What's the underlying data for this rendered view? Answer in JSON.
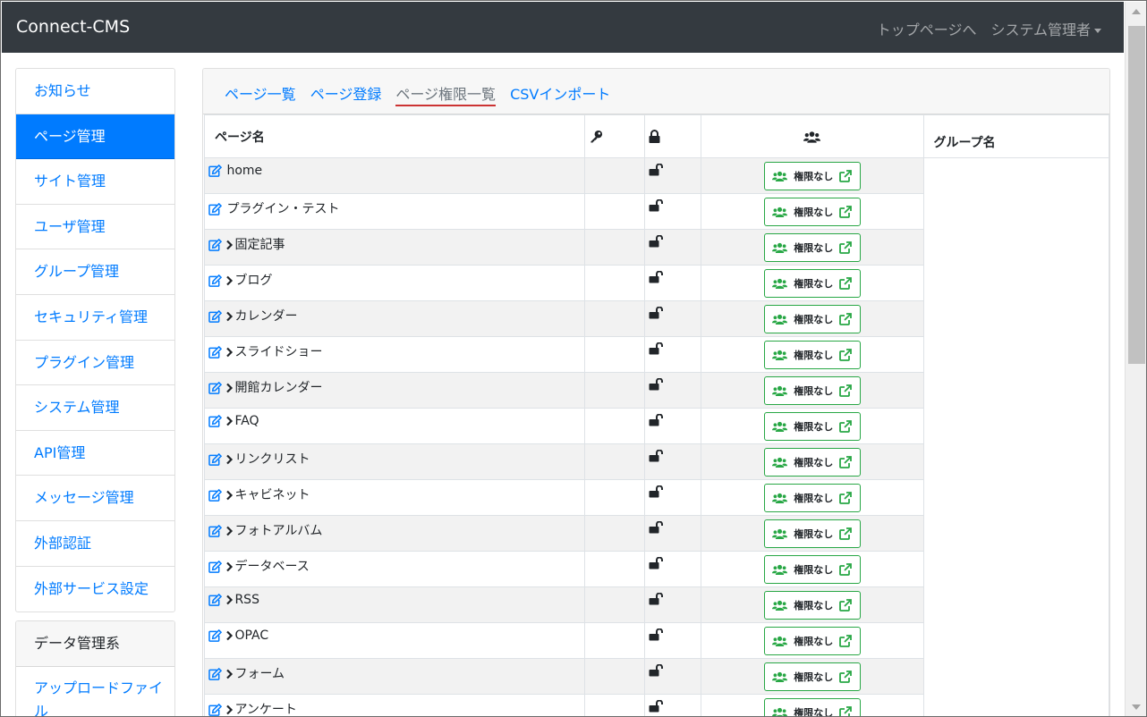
{
  "navbar": {
    "brand": "Connect-CMS",
    "top_page_link": "トップページへ",
    "admin_menu": "システム管理者"
  },
  "sidebar": {
    "items": [
      {
        "label": "お知らせ",
        "active": false
      },
      {
        "label": "ページ管理",
        "active": true
      },
      {
        "label": "サイト管理",
        "active": false
      },
      {
        "label": "ユーザ管理",
        "active": false
      },
      {
        "label": "グループ管理",
        "active": false
      },
      {
        "label": "セキュリティ管理",
        "active": false
      },
      {
        "label": "プラグイン管理",
        "active": false
      },
      {
        "label": "システム管理",
        "active": false
      },
      {
        "label": "API管理",
        "active": false
      },
      {
        "label": "メッセージ管理",
        "active": false
      },
      {
        "label": "外部認証",
        "active": false
      },
      {
        "label": "外部サービス設定",
        "active": false
      }
    ],
    "data_header": "データ管理系",
    "data_items": [
      {
        "label": "アップロードファイル"
      }
    ]
  },
  "tabs": [
    {
      "label": "ページ一覧",
      "current": false
    },
    {
      "label": "ページ登録",
      "current": false
    },
    {
      "label": "ページ権限一覧",
      "current": true
    },
    {
      "label": "CSVインポート",
      "current": false
    }
  ],
  "table": {
    "headers": {
      "page_name": "ページ名",
      "key_icon": "key-icon",
      "lock_icon": "lock-icon",
      "users_icon": "users-icon",
      "group_name": "グループ名"
    },
    "permission_button_label": "権限なし",
    "rows": [
      {
        "name": "home",
        "child": false
      },
      {
        "name": "プラグイン・テスト",
        "child": false
      },
      {
        "name": "固定記事",
        "child": true
      },
      {
        "name": "ブログ",
        "child": true
      },
      {
        "name": "カレンダー",
        "child": true
      },
      {
        "name": "スライドショー",
        "child": true
      },
      {
        "name": "開館カレンダー",
        "child": true
      },
      {
        "name": "FAQ",
        "child": true
      },
      {
        "name": "リンクリスト",
        "child": true
      },
      {
        "name": "キャビネット",
        "child": true
      },
      {
        "name": "フォトアルバム",
        "child": true
      },
      {
        "name": "データベース",
        "child": true
      },
      {
        "name": "RSS",
        "child": true
      },
      {
        "name": "OPAC",
        "child": true
      },
      {
        "name": "フォーム",
        "child": true
      },
      {
        "name": "アンケート",
        "child": true
      }
    ]
  },
  "colors": {
    "navbar_bg": "#343a40",
    "primary": "#007bff",
    "success": "#28a745",
    "tab_underline": "#cc3333"
  }
}
